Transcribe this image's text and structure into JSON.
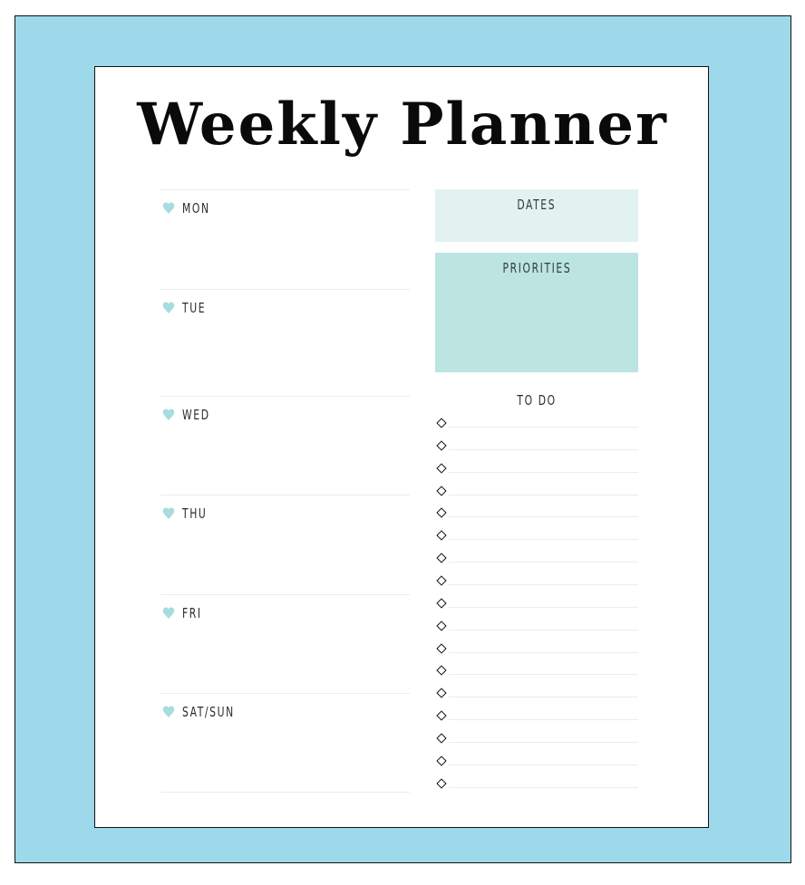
{
  "planner": {
    "title": "Weekly Planner",
    "colors": {
      "frame": "#9dd9ea",
      "heart": "#a9dcdc",
      "dates_box": "#e1f2ef",
      "priorities_box": "#bce4e1"
    },
    "days": [
      {
        "label": "MON",
        "icon": "heart-icon"
      },
      {
        "label": "TUE",
        "icon": "heart-icon"
      },
      {
        "label": "WED",
        "icon": "heart-icon"
      },
      {
        "label": "THU",
        "icon": "heart-icon"
      },
      {
        "label": "FRI",
        "icon": "heart-icon"
      },
      {
        "label": "SAT/SUN",
        "icon": "heart-icon"
      }
    ],
    "dates": {
      "label": "DATES"
    },
    "priorities": {
      "label": "PRIORITIES"
    },
    "todo": {
      "label": "TO DO",
      "item_icon": "diamond-bullet-icon",
      "items": [
        "",
        "",
        "",
        "",
        "",
        "",
        "",
        "",
        "",
        "",
        "",
        "",
        "",
        "",
        "",
        "",
        ""
      ]
    }
  }
}
